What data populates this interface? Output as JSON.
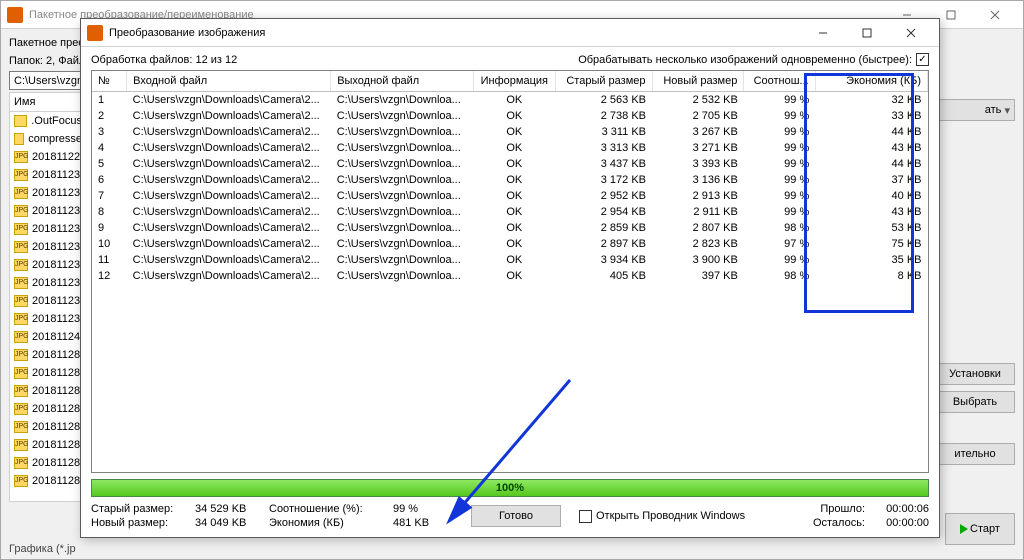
{
  "parent": {
    "title": "Пакетное преобразование/переименование",
    "label": "Пакетное прео",
    "folders_line": "Папок: 2, Файл",
    "path": "C:\\Users\\vzgn",
    "name_col": "Имя",
    "files": [
      {
        "icon": "folder",
        "name": ".OutFocus"
      },
      {
        "icon": "folder",
        "name": "compresse"
      },
      {
        "icon": "jpg",
        "name": "20181122"
      },
      {
        "icon": "jpg",
        "name": "20181123"
      },
      {
        "icon": "jpg",
        "name": "20181123"
      },
      {
        "icon": "jpg",
        "name": "20181123"
      },
      {
        "icon": "jpg",
        "name": "20181123"
      },
      {
        "icon": "jpg",
        "name": "20181123"
      },
      {
        "icon": "jpg",
        "name": "20181123"
      },
      {
        "icon": "jpg",
        "name": "20181123"
      },
      {
        "icon": "jpg",
        "name": "20181123"
      },
      {
        "icon": "jpg",
        "name": "20181123"
      },
      {
        "icon": "jpg",
        "name": "20181124"
      },
      {
        "icon": "jpg",
        "name": "20181128"
      },
      {
        "icon": "jpg",
        "name": "20181128"
      },
      {
        "icon": "jpg",
        "name": "20181128"
      },
      {
        "icon": "jpg",
        "name": "20181128"
      },
      {
        "icon": "jpg",
        "name": "20181128"
      },
      {
        "icon": "jpg",
        "name": "20181128"
      },
      {
        "icon": "jpg",
        "name": "20181128"
      },
      {
        "icon": "jpg",
        "name": "20181128"
      }
    ],
    "right_buttons": {
      "format_combo": "ать",
      "ustanovki": "Установки",
      "vybrat": "Выбрать",
      "itelno": "ительно"
    },
    "bottom": "Графика (*.jp",
    "start": "Старт"
  },
  "dialog": {
    "title": "Преобразование изображения",
    "progress_label": "Обработка файлов: 12 из 12",
    "faster_label": "Обрабатывать несколько изображений одновременно (быстрее):",
    "headers": [
      "№",
      "Входной файл",
      "Выходной файл",
      "Информация",
      "Старый размер",
      "Новый размер",
      "Соотнош...",
      "Экономия (КБ)"
    ],
    "rows": [
      {
        "n": "1",
        "in": "C:\\Users\\vzgn\\Downloads\\Camera\\2...",
        "out": "C:\\Users\\vzgn\\Downloa...",
        "info": "OK",
        "old": "2 563 KB",
        "new": "2 532 KB",
        "pct": "99 %",
        "save": "32 KB"
      },
      {
        "n": "2",
        "in": "C:\\Users\\vzgn\\Downloads\\Camera\\2...",
        "out": "C:\\Users\\vzgn\\Downloa...",
        "info": "OK",
        "old": "2 738 KB",
        "new": "2 705 KB",
        "pct": "99 %",
        "save": "33 KB"
      },
      {
        "n": "3",
        "in": "C:\\Users\\vzgn\\Downloads\\Camera\\2...",
        "out": "C:\\Users\\vzgn\\Downloa...",
        "info": "OK",
        "old": "3 311 KB",
        "new": "3 267 KB",
        "pct": "99 %",
        "save": "44 KB"
      },
      {
        "n": "4",
        "in": "C:\\Users\\vzgn\\Downloads\\Camera\\2...",
        "out": "C:\\Users\\vzgn\\Downloa...",
        "info": "OK",
        "old": "3 313 KB",
        "new": "3 271 KB",
        "pct": "99 %",
        "save": "43 KB"
      },
      {
        "n": "5",
        "in": "C:\\Users\\vzgn\\Downloads\\Camera\\2...",
        "out": "C:\\Users\\vzgn\\Downloa...",
        "info": "OK",
        "old": "3 437 KB",
        "new": "3 393 KB",
        "pct": "99 %",
        "save": "44 KB"
      },
      {
        "n": "6",
        "in": "C:\\Users\\vzgn\\Downloads\\Camera\\2...",
        "out": "C:\\Users\\vzgn\\Downloa...",
        "info": "OK",
        "old": "3 172 KB",
        "new": "3 136 KB",
        "pct": "99 %",
        "save": "37 KB"
      },
      {
        "n": "7",
        "in": "C:\\Users\\vzgn\\Downloads\\Camera\\2...",
        "out": "C:\\Users\\vzgn\\Downloa...",
        "info": "OK",
        "old": "2 952 KB",
        "new": "2 913 KB",
        "pct": "99 %",
        "save": "40 KB"
      },
      {
        "n": "8",
        "in": "C:\\Users\\vzgn\\Downloads\\Camera\\2...",
        "out": "C:\\Users\\vzgn\\Downloa...",
        "info": "OK",
        "old": "2 954 KB",
        "new": "2 911 KB",
        "pct": "99 %",
        "save": "43 KB"
      },
      {
        "n": "9",
        "in": "C:\\Users\\vzgn\\Downloads\\Camera\\2...",
        "out": "C:\\Users\\vzgn\\Downloa...",
        "info": "OK",
        "old": "2 859 KB",
        "new": "2 807 KB",
        "pct": "98 %",
        "save": "53 KB"
      },
      {
        "n": "10",
        "in": "C:\\Users\\vzgn\\Downloads\\Camera\\2...",
        "out": "C:\\Users\\vzgn\\Downloa...",
        "info": "OK",
        "old": "2 897 KB",
        "new": "2 823 KB",
        "pct": "97 %",
        "save": "75 KB"
      },
      {
        "n": "11",
        "in": "C:\\Users\\vzgn\\Downloads\\Camera\\2...",
        "out": "C:\\Users\\vzgn\\Downloa...",
        "info": "OK",
        "old": "3 934 KB",
        "new": "3 900 KB",
        "pct": "99 %",
        "save": "35 KB"
      },
      {
        "n": "12",
        "in": "C:\\Users\\vzgn\\Downloads\\Camera\\2...",
        "out": "C:\\Users\\vzgn\\Downloa...",
        "info": "OK",
        "old": "405 KB",
        "new": "397 KB",
        "pct": "98 %",
        "save": "8 KB"
      }
    ],
    "progress_pct": "100%",
    "stats": {
      "old_label": "Старый размер:",
      "old_val": "34 529 KB",
      "ratio_label": "Соотношение (%):",
      "ratio_val": "99 %",
      "new_label": "Новый размер:",
      "new_val": "34 049 KB",
      "save_label": "Экономия (КБ)",
      "save_val": "481 KB"
    },
    "done_btn": "Готово",
    "open_explorer": "Открыть Проводник Windows",
    "timers": {
      "elapsed_label": "Прошло:",
      "elapsed_val": "00:00:06",
      "remain_label": "Осталось:",
      "remain_val": "00:00:00"
    }
  }
}
